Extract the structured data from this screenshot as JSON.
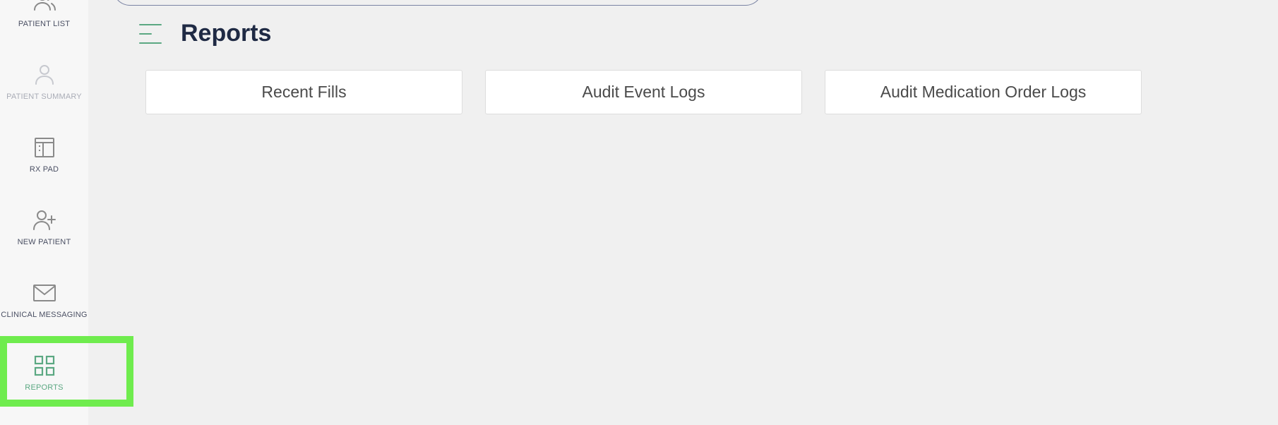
{
  "sidebar": {
    "items": [
      {
        "label": "PATIENT LIST",
        "icon": "users-icon",
        "state": "normal"
      },
      {
        "label": "PATIENT SUMMARY",
        "icon": "user-icon",
        "state": "disabled"
      },
      {
        "label": "RX PAD",
        "icon": "rx-pad-icon",
        "state": "normal"
      },
      {
        "label": "NEW PATIENT",
        "icon": "user-plus-icon",
        "state": "normal"
      },
      {
        "label": "CLINICAL MESSAGING",
        "icon": "mail-icon",
        "state": "normal"
      },
      {
        "label": "REPORTS",
        "icon": "grid-icon",
        "state": "active"
      }
    ]
  },
  "header": {
    "menu_icon": "menu-icon",
    "title": "Reports"
  },
  "reports": {
    "cards": [
      {
        "label": "Recent Fills"
      },
      {
        "label": "Audit Event Logs"
      },
      {
        "label": "Audit Medication Order Logs"
      }
    ]
  },
  "colors": {
    "accent": "#5ba882",
    "highlight": "#6fec4e",
    "title": "#1f2a44",
    "icon": "#8a8a8a"
  }
}
